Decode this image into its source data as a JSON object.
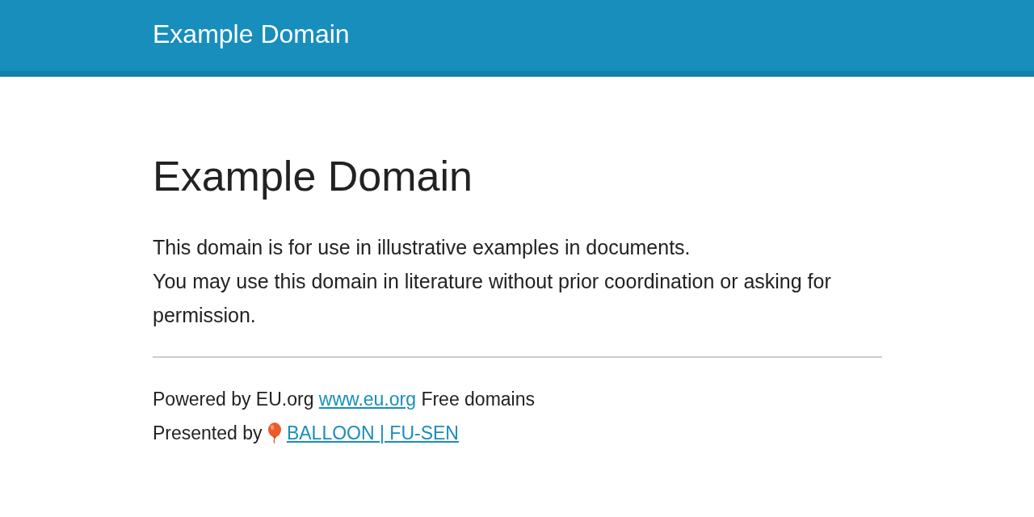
{
  "header": {
    "title": "Example Domain"
  },
  "main": {
    "heading": "Example Domain",
    "paragraphs": [
      "This domain is for use in illustrative examples in documents.",
      "You may use this domain in literature without prior coordination or asking for permission."
    ]
  },
  "footer": {
    "powered": {
      "before": "Powered by EU.org",
      "link": "www.eu.org",
      "after": "Free domains"
    },
    "presented": {
      "before": "Presented by",
      "link": "BALLOON | FU-SEN"
    }
  }
}
